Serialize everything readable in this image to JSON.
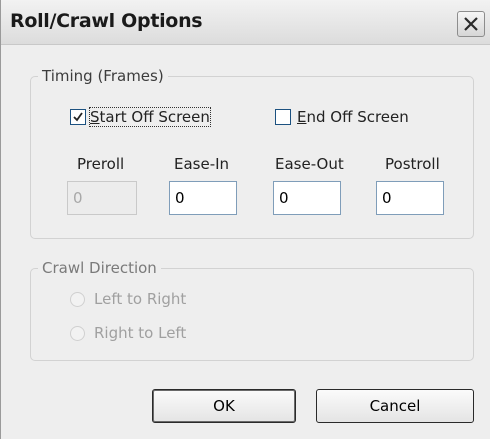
{
  "window": {
    "title": "Roll/Crawl Options",
    "close_icon": "close-icon"
  },
  "timing": {
    "legend": "Timing (Frames)",
    "start_off_screen": {
      "label_prefix": "",
      "label_mnemonic": "S",
      "label_rest": "tart Off Screen",
      "checked": true
    },
    "end_off_screen": {
      "label_prefix": "",
      "label_mnemonic": "E",
      "label_rest": "nd Off Screen",
      "checked": false
    },
    "fields": [
      {
        "label": "Preroll",
        "value": "0",
        "enabled": false
      },
      {
        "label": "Ease-In",
        "value": "0",
        "enabled": true
      },
      {
        "label": "Ease-Out",
        "value": "0",
        "enabled": true
      },
      {
        "label": "Postroll",
        "value": "0",
        "enabled": true
      }
    ]
  },
  "crawl_direction": {
    "legend": "Crawl Direction",
    "enabled": false,
    "options": [
      {
        "label": "Left to Right",
        "selected": false
      },
      {
        "label": "Right to Left",
        "selected": false
      }
    ]
  },
  "buttons": {
    "ok": "OK",
    "cancel": "Cancel"
  },
  "colors": {
    "title_bar": "#dcdcdc",
    "dialog_bg": "#eeeeee",
    "field_border": "#7f9db9",
    "checkbox_border": "#1c5180"
  }
}
